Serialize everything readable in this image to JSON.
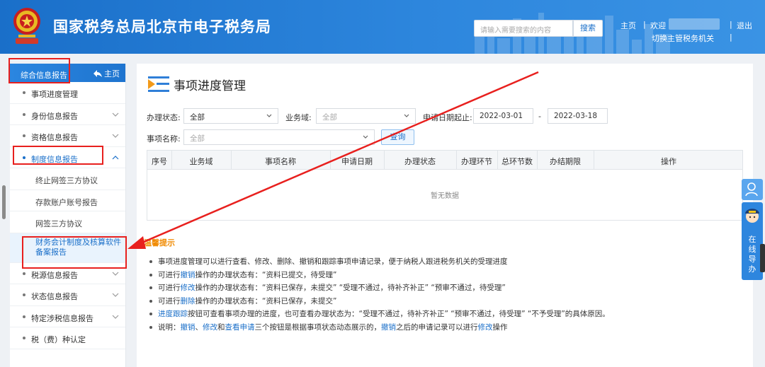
{
  "header": {
    "site_title": "国家税务总局北京市电子税务局",
    "search_placeholder": "请输入需要搜索的内容",
    "search_button": "搜索",
    "home_link": "主页",
    "sep": "|",
    "welcome": "欢迎",
    "logout": "退出",
    "switch_authority": "切换主管税务机关"
  },
  "sidebar": {
    "title": "综合信息报告",
    "home_label": "主页",
    "items": [
      {
        "label": "事项进度管理"
      },
      {
        "label": "身份信息报告"
      },
      {
        "label": "资格信息报告"
      },
      {
        "label": "制度信息报告"
      }
    ],
    "sub_items": [
      {
        "label": "终止网签三方协议"
      },
      {
        "label": "存款账户账号报告"
      },
      {
        "label": "网签三方协议"
      },
      {
        "label": "财务会计制度及核算软件备案报告"
      }
    ],
    "items_after": [
      {
        "label": "税源信息报告"
      },
      {
        "label": "状态信息报告"
      },
      {
        "label": "特定涉税信息报告"
      },
      {
        "label": "税（费）种认定"
      }
    ]
  },
  "main": {
    "page_title": "事项进度管理",
    "filters": {
      "status_label": "办理状态:",
      "status_value": "全部",
      "domain_label": "业务域:",
      "domain_value": "全部",
      "date_label": "申请日期起止:",
      "date_from": "2022-03-01",
      "date_sep": "-",
      "date_to": "2022-03-18",
      "item_label": "事项名称:",
      "item_value": "全部",
      "query_button": "查询"
    },
    "table": {
      "columns": [
        "序号",
        "业务域",
        "事项名称",
        "申请日期",
        "办理状态",
        "办理环节",
        "总环节数",
        "办结期限",
        "操作"
      ],
      "empty_text": "暂无数据"
    },
    "tips_title": "温馨提示",
    "tips": {
      "t1": "事项进度管理可以进行查看、修改、删除、撤销和跟踪事项申请记录，便于纳税人跟进税务机关的受理进度",
      "t2a": "可进行",
      "t2b": "撤销",
      "t2c": "操作的办理状态有：“资料已提交，待受理”",
      "t3a": "可进行",
      "t3b": "修改",
      "t3c": "操作的办理状态有：“资料已保存，未提交”  “受理不通过，待补齐补正”  “预审不通过，待受理”",
      "t4a": "可进行",
      "t4b": "删除",
      "t4c": "操作的办理状态有：“资料已保存，未提交”",
      "t5a": "进度跟踪",
      "t5b": "按钮可查看事项办理的进度，也可查看办理状态为：“受理不通过，待补齐补正”  “预审不通过，待受理”  “不予受理”的具体原因。",
      "t6a": "说明：",
      "t6b": "撤销",
      "t6c": "、",
      "t6d": "修改",
      "t6e": "和",
      "t6f": "查看申请",
      "t6g": "三个按钮是根据事项状态动态展示的，",
      "t6h": "撤销",
      "t6i": "之后的申请记录可以进行",
      "t6j": "修改",
      "t6k": "操作"
    }
  },
  "float_widget": {
    "text": "在线导办"
  },
  "colors": {
    "brand_blue": "#1a6fc9",
    "annotation_red": "#e8201e",
    "tip_orange": "#f08a00"
  }
}
